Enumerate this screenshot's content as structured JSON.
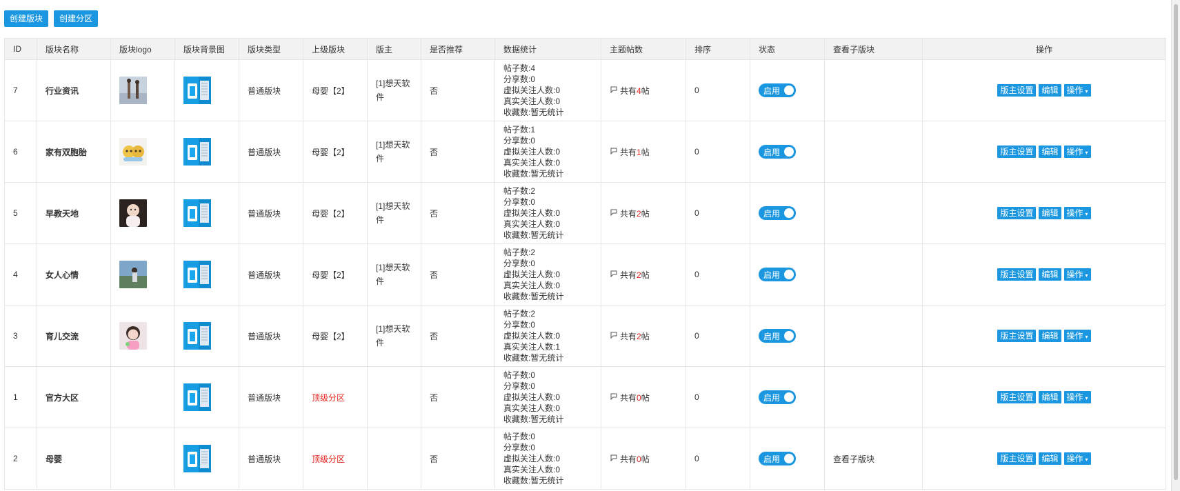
{
  "toolbar": {
    "create_block": "创建版块",
    "create_zone": "创建分区"
  },
  "columns": [
    "ID",
    "版块名称",
    "版块logo",
    "版块背景图",
    "版块类型",
    "上级版块",
    "版主",
    "是否推荐",
    "数据统计",
    "主题帖数",
    "排序",
    "状态",
    "查看子版块",
    "操作"
  ],
  "labels": {
    "posts_prefix": "帖子数:",
    "shares_prefix": "分享数:",
    "virtual_prefix": "虚拟关注人数:",
    "real_prefix": "真实关注人数:",
    "fav_line": "收藏数:暂无统计",
    "topic_prefix": "共有",
    "topic_suffix": "帖",
    "status": "启用",
    "op_mod": "版主设置",
    "op_edit": "编辑",
    "op_more": "操作"
  },
  "colors": {
    "accent": "#1a97e0",
    "red": "#e8211a",
    "header_bg": "#f2f2f2"
  },
  "rows": [
    {
      "id": "7",
      "name": "行业资讯",
      "logo": "couple",
      "type": "普通版块",
      "parent": "母婴【2】",
      "parent_red": false,
      "owner": "[1]想天软件",
      "recommend": "否",
      "posts": "4",
      "shares": "0",
      "virtual": "0",
      "real": "0",
      "topic_count": "4",
      "sort": "0",
      "status": "启用",
      "child_link": ""
    },
    {
      "id": "6",
      "name": "家有双胞胎",
      "logo": "twins",
      "type": "普通版块",
      "parent": "母婴【2】",
      "parent_red": false,
      "owner": "[1]想天软件",
      "recommend": "否",
      "posts": "1",
      "shares": "0",
      "virtual": "0",
      "real": "0",
      "topic_count": "1",
      "sort": "0",
      "status": "启用",
      "child_link": ""
    },
    {
      "id": "5",
      "name": "早教天地",
      "logo": "baby",
      "type": "普通版块",
      "parent": "母婴【2】",
      "parent_red": false,
      "owner": "[1]想天软件",
      "recommend": "否",
      "posts": "2",
      "shares": "0",
      "virtual": "0",
      "real": "0",
      "topic_count": "2",
      "sort": "0",
      "status": "启用",
      "child_link": ""
    },
    {
      "id": "4",
      "name": "女人心情",
      "logo": "woman",
      "type": "普通版块",
      "parent": "母婴【2】",
      "parent_red": false,
      "owner": "[1]想天软件",
      "recommend": "否",
      "posts": "2",
      "shares": "0",
      "virtual": "0",
      "real": "0",
      "topic_count": "2",
      "sort": "0",
      "status": "启用",
      "child_link": ""
    },
    {
      "id": "3",
      "name": "育儿交流",
      "logo": "girl",
      "type": "普通版块",
      "parent": "母婴【2】",
      "parent_red": false,
      "owner": "[1]想天软件",
      "recommend": "否",
      "posts": "2",
      "shares": "0",
      "virtual": "0",
      "real": "1",
      "topic_count": "2",
      "sort": "0",
      "status": "启用",
      "child_link": ""
    },
    {
      "id": "1",
      "name": "官方大区",
      "logo": "",
      "type": "普通版块",
      "parent": "顶级分区",
      "parent_red": true,
      "owner": "",
      "recommend": "否",
      "posts": "0",
      "shares": "0",
      "virtual": "0",
      "real": "0",
      "topic_count": "0",
      "sort": "0",
      "status": "启用",
      "child_link": ""
    },
    {
      "id": "2",
      "name": "母婴",
      "logo": "",
      "type": "普通版块",
      "parent": "顶级分区",
      "parent_red": true,
      "owner": "",
      "recommend": "否",
      "posts": "0",
      "shares": "0",
      "virtual": "0",
      "real": "0",
      "topic_count": "0",
      "sort": "0",
      "status": "启用",
      "child_link": "查看子版块"
    }
  ]
}
